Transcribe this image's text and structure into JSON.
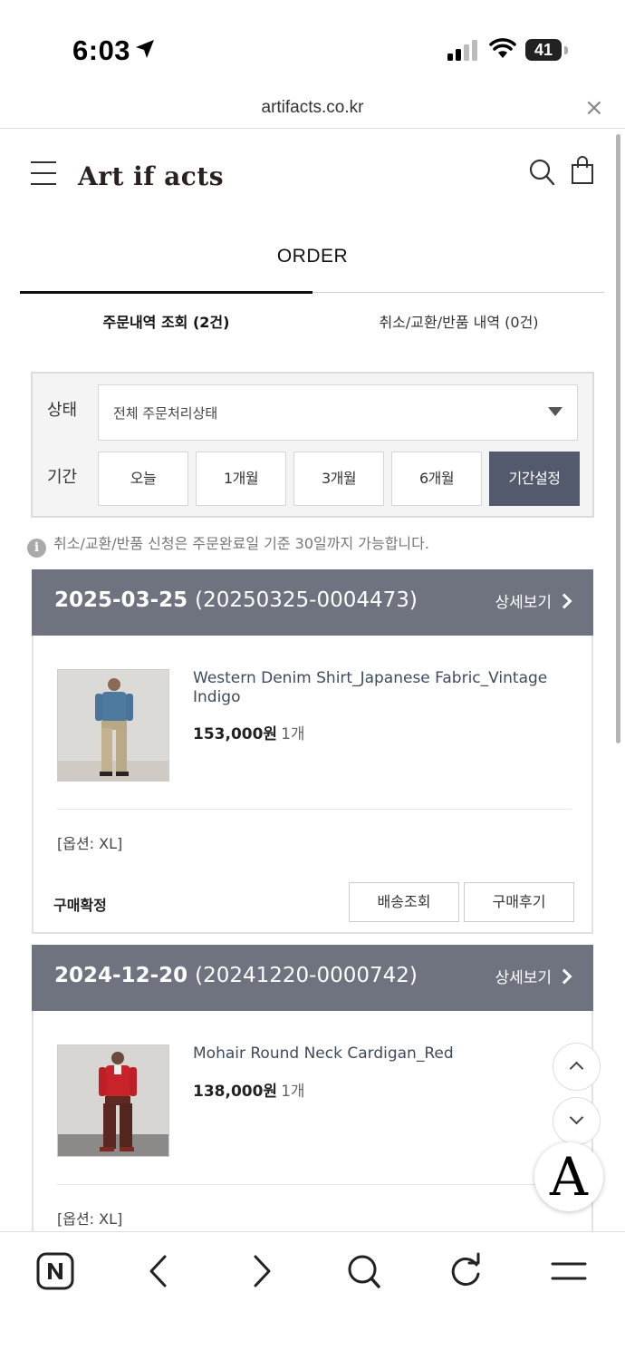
{
  "status_bar": {
    "time": "6:03",
    "battery": "41"
  },
  "browser": {
    "url": "artifacts.co.kr",
    "close_glyph": "×",
    "toolbar": [
      "naver-icon",
      "back-icon",
      "forward-icon",
      "search-icon",
      "reload-icon",
      "menu-icon"
    ]
  },
  "header": {
    "logo": "Art if acts"
  },
  "page": {
    "title": "ORDER",
    "tabs": [
      {
        "label": "주문내역 조회 (2건)",
        "active": true
      },
      {
        "label": "취소/교환/반품 내역 (0건)",
        "active": false
      }
    ]
  },
  "filter": {
    "status_label": "상태",
    "status_value": "전체 주문처리상태",
    "period_label": "기간",
    "periods": [
      {
        "label": "오늘",
        "active": false
      },
      {
        "label": "1개월",
        "active": false
      },
      {
        "label": "3개월",
        "active": false
      },
      {
        "label": "6개월",
        "active": false
      },
      {
        "label": "기간설정",
        "active": true
      }
    ]
  },
  "notice": {
    "icon": "i",
    "text": "취소/교환/반품 신청은 주문완료일 기준 30일까지 가능합니다."
  },
  "orders": [
    {
      "date": "2025-03-25",
      "order_no": "(20250325-0004473)",
      "detail_label": "상세보기",
      "product_name": "Western Denim Shirt_Japanese Fabric_Vintage Indigo",
      "price": "153,000원",
      "qty": "1개",
      "option": "[옵션: XL]",
      "state": "구매확정",
      "actions": [
        "배송조회",
        "구매후기"
      ]
    },
    {
      "date": "2024-12-20",
      "order_no": "(20241220-0000742)",
      "detail_label": "상세보기",
      "product_name": "Mohair Round Neck Cardigan_Red",
      "price": "138,000원",
      "qty": "1개",
      "option": "[옵션: XL]"
    }
  ],
  "floating": {
    "brand_letter": "A"
  },
  "colors": {
    "card_header": "#6f7380",
    "active_period": "#535a6e",
    "product_name": "#3e4a5e"
  }
}
